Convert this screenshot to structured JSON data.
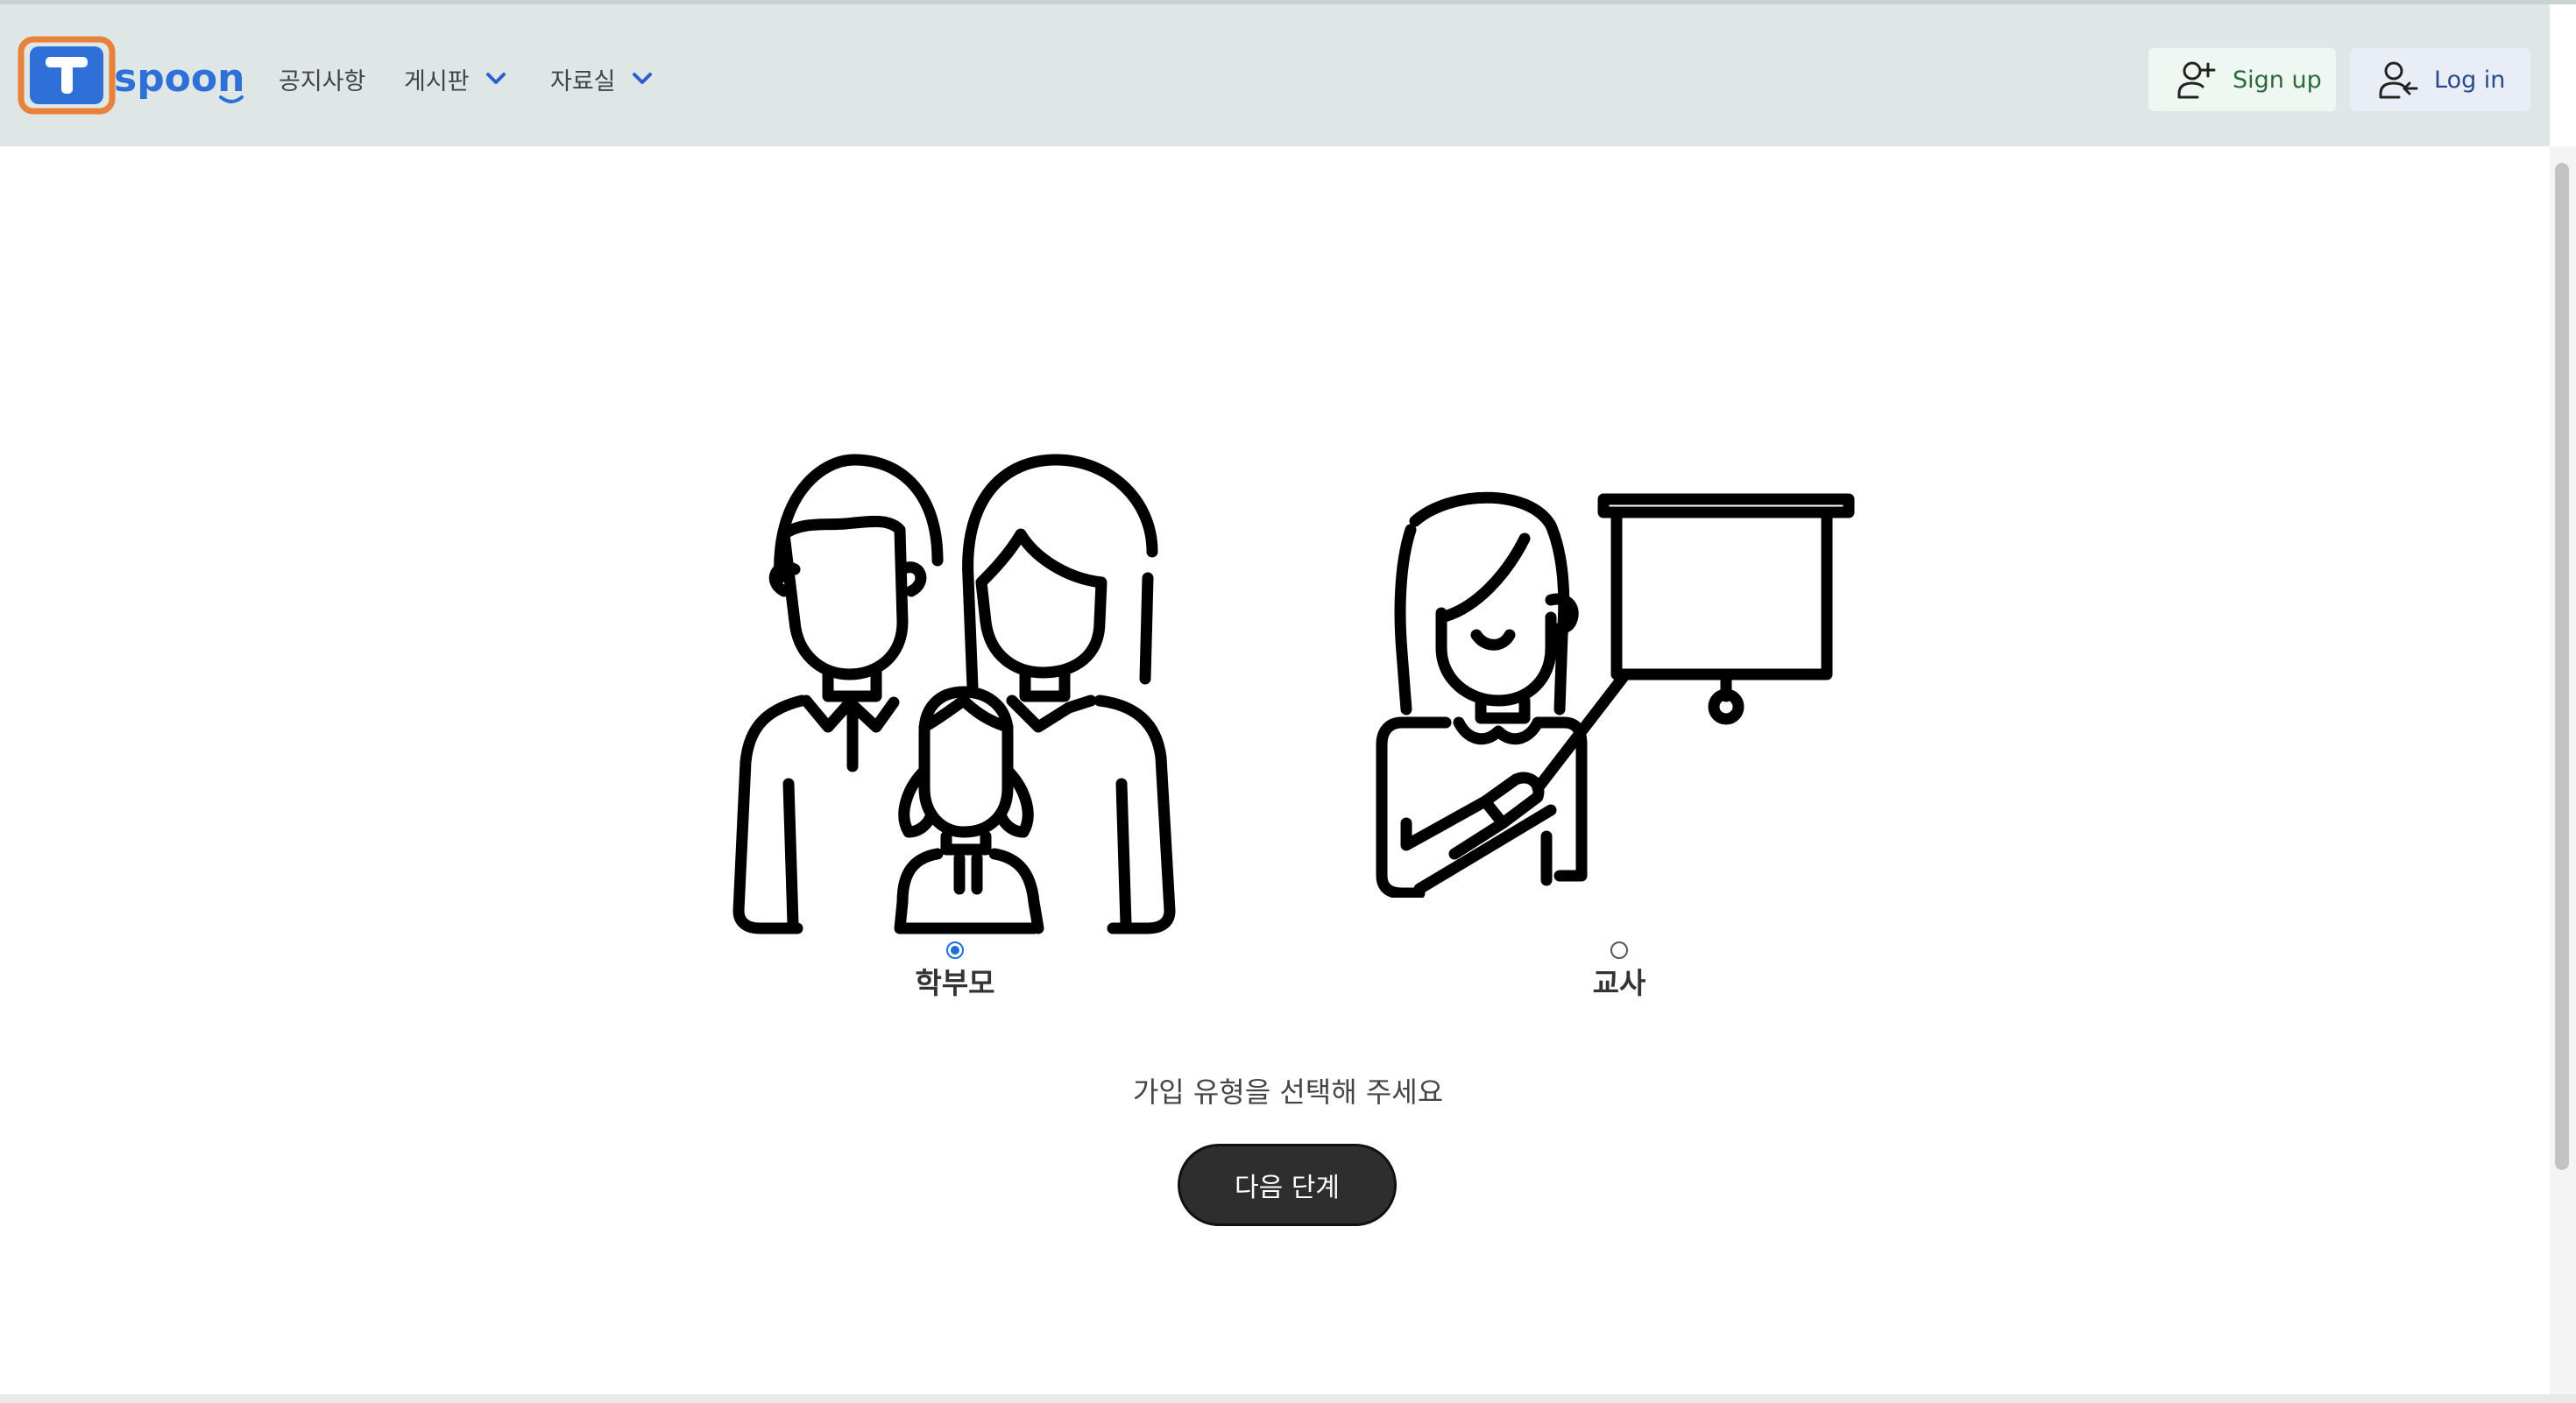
{
  "brand": {
    "name": "spoon",
    "colors": {
      "orange": "#e8823a",
      "blue": "#2f6fd8"
    }
  },
  "nav": {
    "items": [
      {
        "label": "공지사항",
        "dropdown": false
      },
      {
        "label": "게시판",
        "dropdown": true
      },
      {
        "label": "자료실",
        "dropdown": true
      }
    ]
  },
  "auth": {
    "signup_label": "Sign up",
    "login_label": "Log in"
  },
  "options": [
    {
      "label": "학부모",
      "icon": "family-icon",
      "selected": true
    },
    {
      "label": "교사",
      "icon": "teacher-icon",
      "selected": false
    }
  ],
  "prompt": "가입 유형을 선택해 주세요",
  "next_button": "다음 단계"
}
